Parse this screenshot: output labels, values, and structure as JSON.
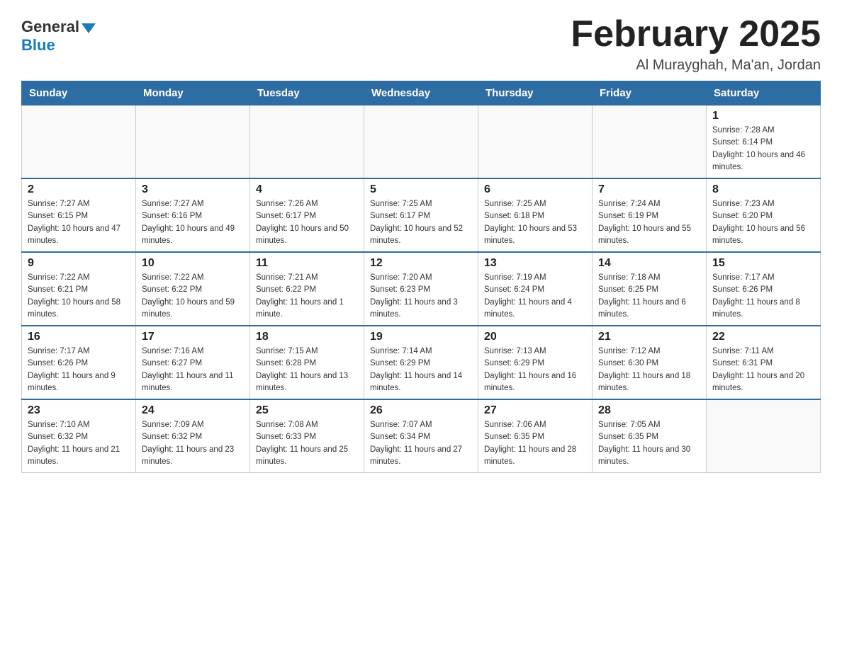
{
  "header": {
    "logo_general": "General",
    "logo_blue": "Blue",
    "month_title": "February 2025",
    "location": "Al Murayghah, Ma'an, Jordan"
  },
  "days_of_week": [
    "Sunday",
    "Monday",
    "Tuesday",
    "Wednesday",
    "Thursday",
    "Friday",
    "Saturday"
  ],
  "weeks": [
    [
      {
        "day": "",
        "info": ""
      },
      {
        "day": "",
        "info": ""
      },
      {
        "day": "",
        "info": ""
      },
      {
        "day": "",
        "info": ""
      },
      {
        "day": "",
        "info": ""
      },
      {
        "day": "",
        "info": ""
      },
      {
        "day": "1",
        "info": "Sunrise: 7:28 AM\nSunset: 6:14 PM\nDaylight: 10 hours and 46 minutes."
      }
    ],
    [
      {
        "day": "2",
        "info": "Sunrise: 7:27 AM\nSunset: 6:15 PM\nDaylight: 10 hours and 47 minutes."
      },
      {
        "day": "3",
        "info": "Sunrise: 7:27 AM\nSunset: 6:16 PM\nDaylight: 10 hours and 49 minutes."
      },
      {
        "day": "4",
        "info": "Sunrise: 7:26 AM\nSunset: 6:17 PM\nDaylight: 10 hours and 50 minutes."
      },
      {
        "day": "5",
        "info": "Sunrise: 7:25 AM\nSunset: 6:17 PM\nDaylight: 10 hours and 52 minutes."
      },
      {
        "day": "6",
        "info": "Sunrise: 7:25 AM\nSunset: 6:18 PM\nDaylight: 10 hours and 53 minutes."
      },
      {
        "day": "7",
        "info": "Sunrise: 7:24 AM\nSunset: 6:19 PM\nDaylight: 10 hours and 55 minutes."
      },
      {
        "day": "8",
        "info": "Sunrise: 7:23 AM\nSunset: 6:20 PM\nDaylight: 10 hours and 56 minutes."
      }
    ],
    [
      {
        "day": "9",
        "info": "Sunrise: 7:22 AM\nSunset: 6:21 PM\nDaylight: 10 hours and 58 minutes."
      },
      {
        "day": "10",
        "info": "Sunrise: 7:22 AM\nSunset: 6:22 PM\nDaylight: 10 hours and 59 minutes."
      },
      {
        "day": "11",
        "info": "Sunrise: 7:21 AM\nSunset: 6:22 PM\nDaylight: 11 hours and 1 minute."
      },
      {
        "day": "12",
        "info": "Sunrise: 7:20 AM\nSunset: 6:23 PM\nDaylight: 11 hours and 3 minutes."
      },
      {
        "day": "13",
        "info": "Sunrise: 7:19 AM\nSunset: 6:24 PM\nDaylight: 11 hours and 4 minutes."
      },
      {
        "day": "14",
        "info": "Sunrise: 7:18 AM\nSunset: 6:25 PM\nDaylight: 11 hours and 6 minutes."
      },
      {
        "day": "15",
        "info": "Sunrise: 7:17 AM\nSunset: 6:26 PM\nDaylight: 11 hours and 8 minutes."
      }
    ],
    [
      {
        "day": "16",
        "info": "Sunrise: 7:17 AM\nSunset: 6:26 PM\nDaylight: 11 hours and 9 minutes."
      },
      {
        "day": "17",
        "info": "Sunrise: 7:16 AM\nSunset: 6:27 PM\nDaylight: 11 hours and 11 minutes."
      },
      {
        "day": "18",
        "info": "Sunrise: 7:15 AM\nSunset: 6:28 PM\nDaylight: 11 hours and 13 minutes."
      },
      {
        "day": "19",
        "info": "Sunrise: 7:14 AM\nSunset: 6:29 PM\nDaylight: 11 hours and 14 minutes."
      },
      {
        "day": "20",
        "info": "Sunrise: 7:13 AM\nSunset: 6:29 PM\nDaylight: 11 hours and 16 minutes."
      },
      {
        "day": "21",
        "info": "Sunrise: 7:12 AM\nSunset: 6:30 PM\nDaylight: 11 hours and 18 minutes."
      },
      {
        "day": "22",
        "info": "Sunrise: 7:11 AM\nSunset: 6:31 PM\nDaylight: 11 hours and 20 minutes."
      }
    ],
    [
      {
        "day": "23",
        "info": "Sunrise: 7:10 AM\nSunset: 6:32 PM\nDaylight: 11 hours and 21 minutes."
      },
      {
        "day": "24",
        "info": "Sunrise: 7:09 AM\nSunset: 6:32 PM\nDaylight: 11 hours and 23 minutes."
      },
      {
        "day": "25",
        "info": "Sunrise: 7:08 AM\nSunset: 6:33 PM\nDaylight: 11 hours and 25 minutes."
      },
      {
        "day": "26",
        "info": "Sunrise: 7:07 AM\nSunset: 6:34 PM\nDaylight: 11 hours and 27 minutes."
      },
      {
        "day": "27",
        "info": "Sunrise: 7:06 AM\nSunset: 6:35 PM\nDaylight: 11 hours and 28 minutes."
      },
      {
        "day": "28",
        "info": "Sunrise: 7:05 AM\nSunset: 6:35 PM\nDaylight: 11 hours and 30 minutes."
      },
      {
        "day": "",
        "info": ""
      }
    ]
  ]
}
